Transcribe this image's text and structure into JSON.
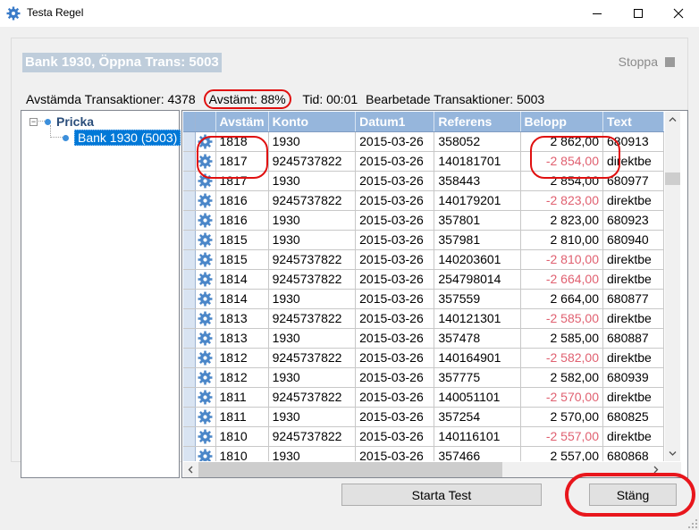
{
  "window": {
    "title": "Testa Regel",
    "icon": "gear-icon",
    "controls": [
      "minimize-icon",
      "maximize-icon",
      "close-icon"
    ]
  },
  "header": {
    "title": "Bank 1930, Öppna Trans: 5003",
    "stop_label": "Stoppa"
  },
  "stats": {
    "matched": "Avstämda Transaktioner: 4378",
    "percent": "Avstämt: 88%",
    "time": "Tid: 00:01",
    "processed": "Bearbetade Transaktioner: 5003"
  },
  "tree": {
    "root_label": "Pricka",
    "child_label": "Bank 1930 (5003)"
  },
  "grid": {
    "columns": [
      "Avstäm",
      "Konto",
      "Datum1",
      "Referens",
      "Belopp",
      "Text"
    ],
    "rows": [
      {
        "avstam": "1818",
        "konto": "1930",
        "datum": "2015-03-26",
        "referens": "358052",
        "belopp": "2 862,00",
        "text": "680913",
        "neg": false
      },
      {
        "avstam": "1817",
        "konto": "9245737822",
        "datum": "2015-03-26",
        "referens": "140181701",
        "belopp": "-2 854,00",
        "text": "direktbe",
        "neg": true
      },
      {
        "avstam": "1817",
        "konto": "1930",
        "datum": "2015-03-26",
        "referens": "358443",
        "belopp": "2 854,00",
        "text": "680977",
        "neg": false
      },
      {
        "avstam": "1816",
        "konto": "9245737822",
        "datum": "2015-03-26",
        "referens": "140179201",
        "belopp": "-2 823,00",
        "text": "direktbe",
        "neg": true
      },
      {
        "avstam": "1816",
        "konto": "1930",
        "datum": "2015-03-26",
        "referens": "357801",
        "belopp": "2 823,00",
        "text": "680923",
        "neg": false
      },
      {
        "avstam": "1815",
        "konto": "1930",
        "datum": "2015-03-26",
        "referens": "357981",
        "belopp": "2 810,00",
        "text": "680940",
        "neg": false
      },
      {
        "avstam": "1815",
        "konto": "9245737822",
        "datum": "2015-03-26",
        "referens": "140203601",
        "belopp": "-2 810,00",
        "text": "direktbe",
        "neg": true
      },
      {
        "avstam": "1814",
        "konto": "9245737822",
        "datum": "2015-03-26",
        "referens": "254798014",
        "belopp": "-2 664,00",
        "text": "direktbe",
        "neg": true
      },
      {
        "avstam": "1814",
        "konto": "1930",
        "datum": "2015-03-26",
        "referens": "357559",
        "belopp": "2 664,00",
        "text": "680877",
        "neg": false
      },
      {
        "avstam": "1813",
        "konto": "9245737822",
        "datum": "2015-03-26",
        "referens": "140121301",
        "belopp": "-2 585,00",
        "text": "direktbe",
        "neg": true
      },
      {
        "avstam": "1813",
        "konto": "1930",
        "datum": "2015-03-26",
        "referens": "357478",
        "belopp": "2 585,00",
        "text": "680887",
        "neg": false
      },
      {
        "avstam": "1812",
        "konto": "9245737822",
        "datum": "2015-03-26",
        "referens": "140164901",
        "belopp": "-2 582,00",
        "text": "direktbe",
        "neg": true
      },
      {
        "avstam": "1812",
        "konto": "1930",
        "datum": "2015-03-26",
        "referens": "357775",
        "belopp": "2 582,00",
        "text": "680939",
        "neg": false
      },
      {
        "avstam": "1811",
        "konto": "9245737822",
        "datum": "2015-03-26",
        "referens": "140051101",
        "belopp": "-2 570,00",
        "text": "direktbe",
        "neg": true
      },
      {
        "avstam": "1811",
        "konto": "1930",
        "datum": "2015-03-26",
        "referens": "357254",
        "belopp": "2 570,00",
        "text": "680825",
        "neg": false
      },
      {
        "avstam": "1810",
        "konto": "9245737822",
        "datum": "2015-03-26",
        "referens": "140116101",
        "belopp": "-2 557,00",
        "text": "direktbe",
        "neg": true
      },
      {
        "avstam": "1810",
        "konto": "1930",
        "datum": "2015-03-26",
        "referens": "357466",
        "belopp": "2 557,00",
        "text": "680868",
        "neg": false
      }
    ]
  },
  "buttons": {
    "start_test": "Starta Test",
    "close": "Stäng"
  },
  "colors": {
    "header_bg": "#96b6dc",
    "negative_amount": "#e06070",
    "annotation_red": "#e01010",
    "selection_blue": "#0078d7"
  }
}
